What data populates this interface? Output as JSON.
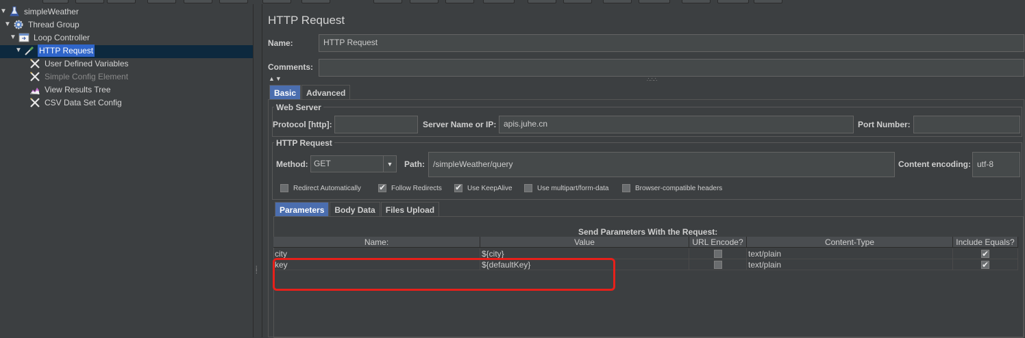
{
  "tree": {
    "items": [
      {
        "label": "simpleWeather",
        "icon": "flask-icon",
        "arrow": "▼",
        "dim": false
      },
      {
        "label": "Thread Group",
        "icon": "gear-icon",
        "arrow": "▼",
        "dim": false
      },
      {
        "label": "Loop Controller",
        "icon": "loop-controller-icon",
        "arrow": "▼",
        "dim": false
      },
      {
        "label": "HTTP Request",
        "icon": "pipette-icon",
        "arrow": "▼",
        "dim": false,
        "selected": true
      },
      {
        "label": "User Defined Variables",
        "icon": "wrench-icon",
        "arrow": "",
        "dim": false
      },
      {
        "label": "Simple Config Element",
        "icon": "wrench-icon",
        "arrow": "",
        "dim": true
      },
      {
        "label": "View Results Tree",
        "icon": "chart-icon",
        "arrow": "",
        "dim": false
      },
      {
        "label": "CSV Data Set Config",
        "icon": "wrench-icon",
        "arrow": "",
        "dim": false
      }
    ]
  },
  "panel": {
    "title": "HTTP Request",
    "name_label": "Name:",
    "name_value": "HTTP Request",
    "comments_label": "Comments:",
    "comments_value": "",
    "tabs": [
      "Basic",
      "Advanced"
    ],
    "web_server": {
      "title": "Web Server",
      "protocol_label": "Protocol [http]:",
      "protocol_value": "",
      "server_label": "Server Name or IP:",
      "server_value": "apis.juhe.cn",
      "port_label": "Port Number:",
      "port_value": ""
    },
    "http_request": {
      "title": "HTTP Request",
      "method_label": "Method:",
      "method_value": "GET",
      "path_label": "Path:",
      "path_value": "/simpleWeather/query",
      "encoding_label": "Content encoding:",
      "encoding_value": "utf-8",
      "checkboxes": [
        {
          "label": "Redirect Automatically",
          "checked": false
        },
        {
          "label": "Follow Redirects",
          "checked": true
        },
        {
          "label": "Use KeepAlive",
          "checked": true
        },
        {
          "label": "Use multipart/form-data",
          "checked": false
        },
        {
          "label": "Browser-compatible headers",
          "checked": false
        }
      ]
    },
    "subtabs": [
      "Parameters",
      "Body Data",
      "Files Upload"
    ],
    "params": {
      "title": "Send Parameters With the Request:",
      "columns": [
        "Name:",
        "Value",
        "URL Encode?",
        "Content-Type",
        "Include Equals?"
      ],
      "rows": [
        {
          "name": "city",
          "value": "${city}",
          "url_encode": false,
          "content_type": "text/plain",
          "include_equals": true
        },
        {
          "name": "key",
          "value": "${defaultKey}",
          "url_encode": false,
          "content_type": "text/plain",
          "include_equals": true
        }
      ]
    }
  },
  "colors": {
    "background": "#3c3f41",
    "selection": "#2f65ca",
    "active_tab": "#4b6eaf",
    "annotation": "#e8201a"
  }
}
